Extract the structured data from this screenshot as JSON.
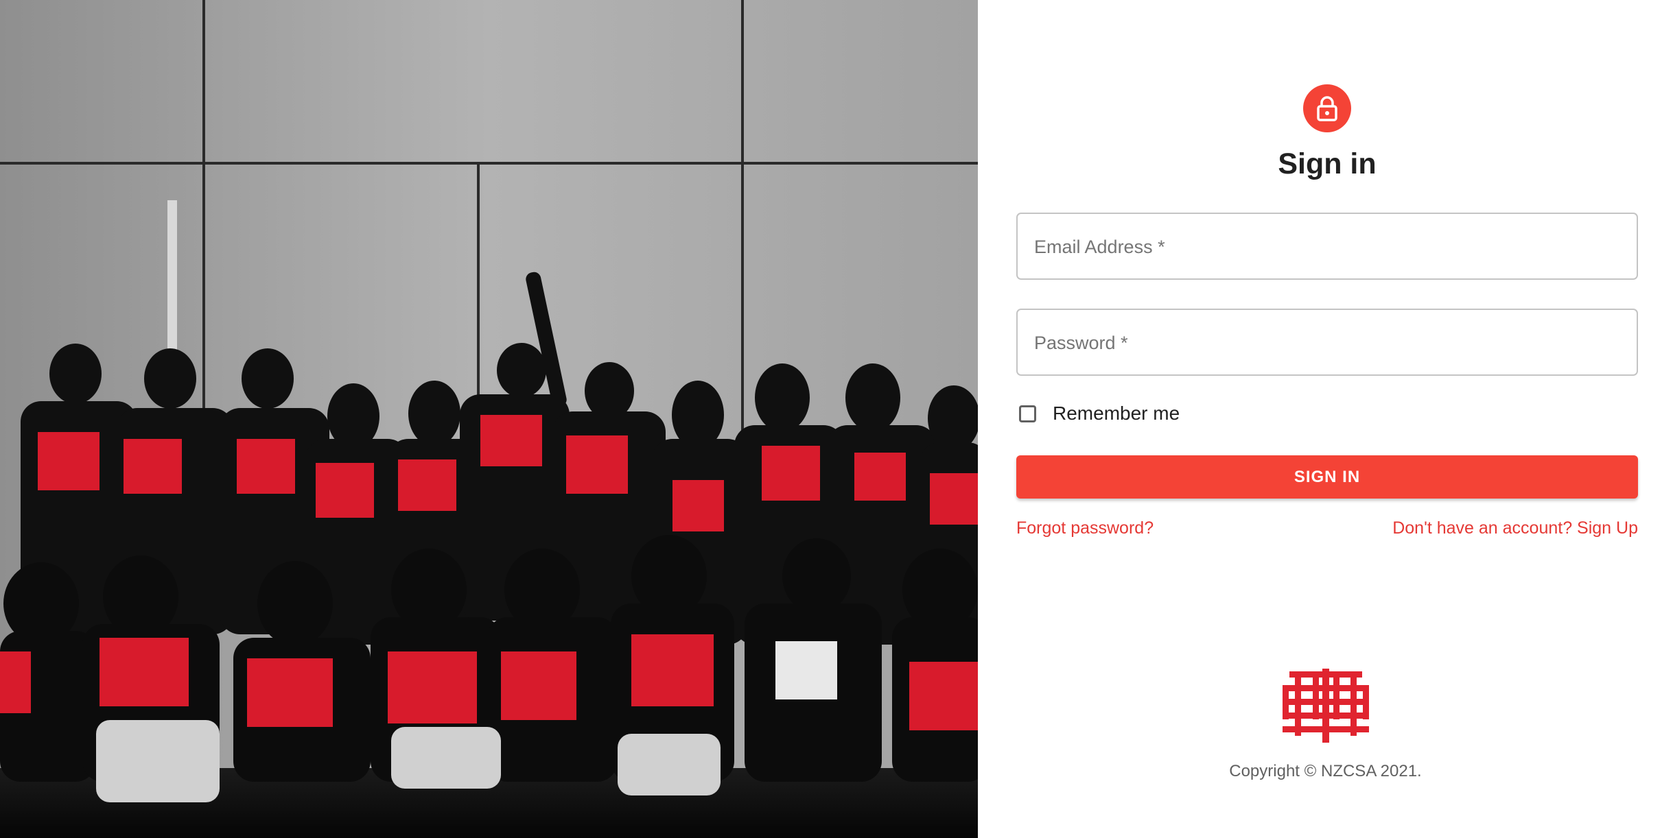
{
  "hero": {
    "image_icon": "group-photo-image"
  },
  "form": {
    "lock_icon": "lock-icon",
    "title": "Sign in",
    "email": {
      "label": "Email Address *",
      "value": ""
    },
    "password": {
      "label": "Password *",
      "value": ""
    },
    "remember_label": "Remember me",
    "submit_label": "SIGN IN",
    "forgot_link": "Forgot password?",
    "signup_link": "Don't have an account? Sign Up"
  },
  "footer": {
    "logo_icon": "nzcsa-logo-icon",
    "copyright": "Copyright © NZCSA 2021."
  },
  "colors": {
    "accent": "#f44336",
    "link": "#e53935",
    "border": "#c4c4c4"
  }
}
